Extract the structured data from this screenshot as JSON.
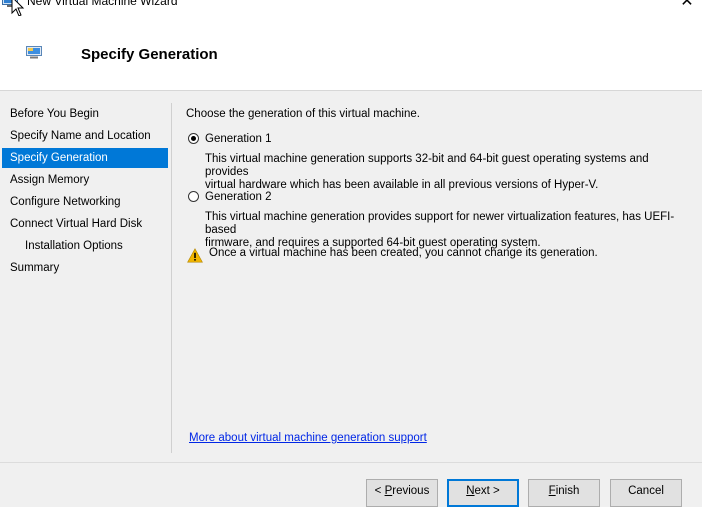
{
  "window": {
    "title": "New Virtual Machine Wizard"
  },
  "header": {
    "title": "Specify Generation"
  },
  "sidebar": {
    "items": [
      {
        "label": "Before You Begin"
      },
      {
        "label": "Specify Name and Location"
      },
      {
        "label": "Specify Generation"
      },
      {
        "label": "Assign Memory"
      },
      {
        "label": "Configure Networking"
      },
      {
        "label": "Connect Virtual Hard Disk"
      },
      {
        "label": "Installation Options"
      },
      {
        "label": "Summary"
      }
    ],
    "active_index": 2
  },
  "main": {
    "prompt": "Choose the generation of this virtual machine.",
    "options": [
      {
        "label": "Generation 1",
        "selected": true,
        "description_line1": "This virtual machine generation supports 32-bit and 64-bit guest operating systems and provides",
        "description_line2": "virtual hardware which has been available in all previous versions of Hyper-V."
      },
      {
        "label": "Generation 2",
        "selected": false,
        "description_line1": "This virtual machine generation provides support for newer virtualization features, has UEFI-based",
        "description_line2": "firmware, and requires a supported 64-bit guest operating system."
      }
    ],
    "warning": "Once a virtual machine has been created, you cannot change its generation.",
    "link": "More about virtual machine generation support"
  },
  "buttons": {
    "previous_prefix": "< ",
    "previous_access": "P",
    "previous_rest": "revious",
    "next_access": "N",
    "next_rest": "ext >",
    "finish_access": "F",
    "finish_rest": "inish",
    "cancel": "Cancel"
  },
  "colors": {
    "accent": "#0078d7",
    "link": "#0026e6",
    "warning": "#f0b400"
  }
}
